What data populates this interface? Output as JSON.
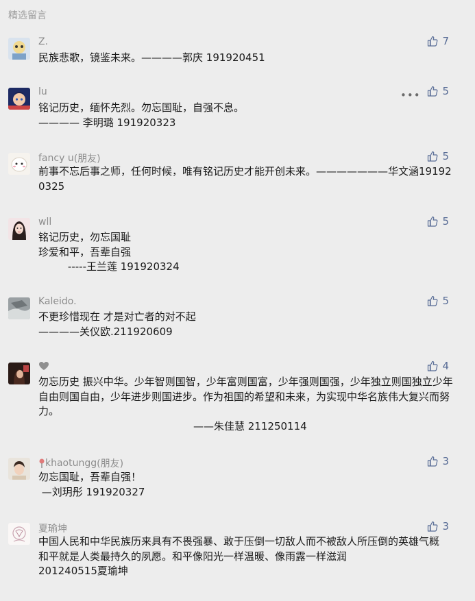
{
  "section_title": "精选留言",
  "comments": [
    {
      "name": "Z.",
      "likes": "7",
      "lines": [
        "民族悲歌，镜鉴未来。————郭庆 191920451"
      ]
    },
    {
      "name": "lu",
      "likes": "5",
      "more": "•••",
      "lines": [
        "铭记历史，缅怀先烈。勿忘国耻，自强不息。",
        "———— 李明璐 191920323"
      ]
    },
    {
      "name": "fancy u",
      "tag": "(朋友)",
      "likes": "5",
      "text": "前事不忘后事之师，任何时候，唯有铭记历史才能开创未来。———————华文涵191920325"
    },
    {
      "name": "wll",
      "likes": "5",
      "lines": [
        "铭记历史，勿忘国耻",
        "珍爱和平，吾辈自强",
        "         -----王兰莲 191920324"
      ]
    },
    {
      "name": "Kaleido.",
      "likes": "5",
      "lines": [
        "不更珍惜现在 才是对亡者的对不起",
        "————关仪欧.211920609"
      ]
    },
    {
      "name": "",
      "likes": "4",
      "text": "勿忘历史 振兴中华。少年智则国智，少年富则国富，少年强则国强，少年独立则国独立少年自由则国自由，少年进步则国进步。作为祖国的希望和未来，为实现中华名族伟大复兴而努力。",
      "signature": "——朱佳慧 211250114"
    },
    {
      "name": "khaotungg",
      "tag": "(朋友)",
      "likes": "3",
      "lines": [
        "勿忘国耻，吾辈自强！",
        " —刘玥彤 191920327"
      ]
    },
    {
      "name": "夏瑜坤",
      "likes": "3",
      "text": "中国人民和中华民族历来具有不畏强暴、敢于压倒一切敌人而不被敌人所压倒的英雄气概",
      "lines": [
        "和平就是人类最持久的夙愿。和平像阳光一样温暖、像雨露一样滋润",
        "201240515夏瑜坤"
      ]
    }
  ],
  "icons": {
    "like": "thumbs-up-icon",
    "more": "more-dots-icon",
    "heart": "heart-icon",
    "pin": "pin-icon"
  },
  "colors": {
    "background": "#ededed",
    "like": "#576b95",
    "name": "#8c8c8c",
    "text": "#1a1a1a"
  }
}
